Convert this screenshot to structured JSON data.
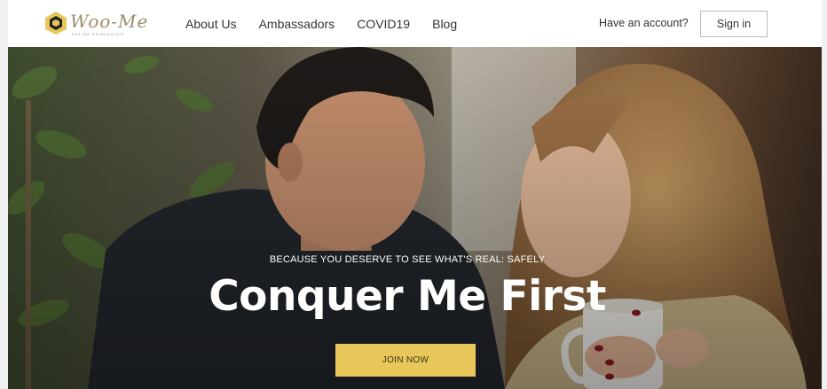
{
  "brand": {
    "logo_text": "Woo-Me",
    "logo_tagline": "DATING REINVENTED",
    "accent_color": "#e8c75a"
  },
  "nav": {
    "links": [
      "About Us",
      "Ambassadors",
      "COVID19",
      "Blog"
    ],
    "account_prompt": "Have an account?",
    "signin_label": "Sign in"
  },
  "hero": {
    "subtitle": "BECAUSE YOU DESERVE TO SEE WHAT'S REAL: SAFELY",
    "title": "Conquer Me First",
    "cta_label": "JOIN NOW",
    "image": "couple-coffee-photo"
  }
}
